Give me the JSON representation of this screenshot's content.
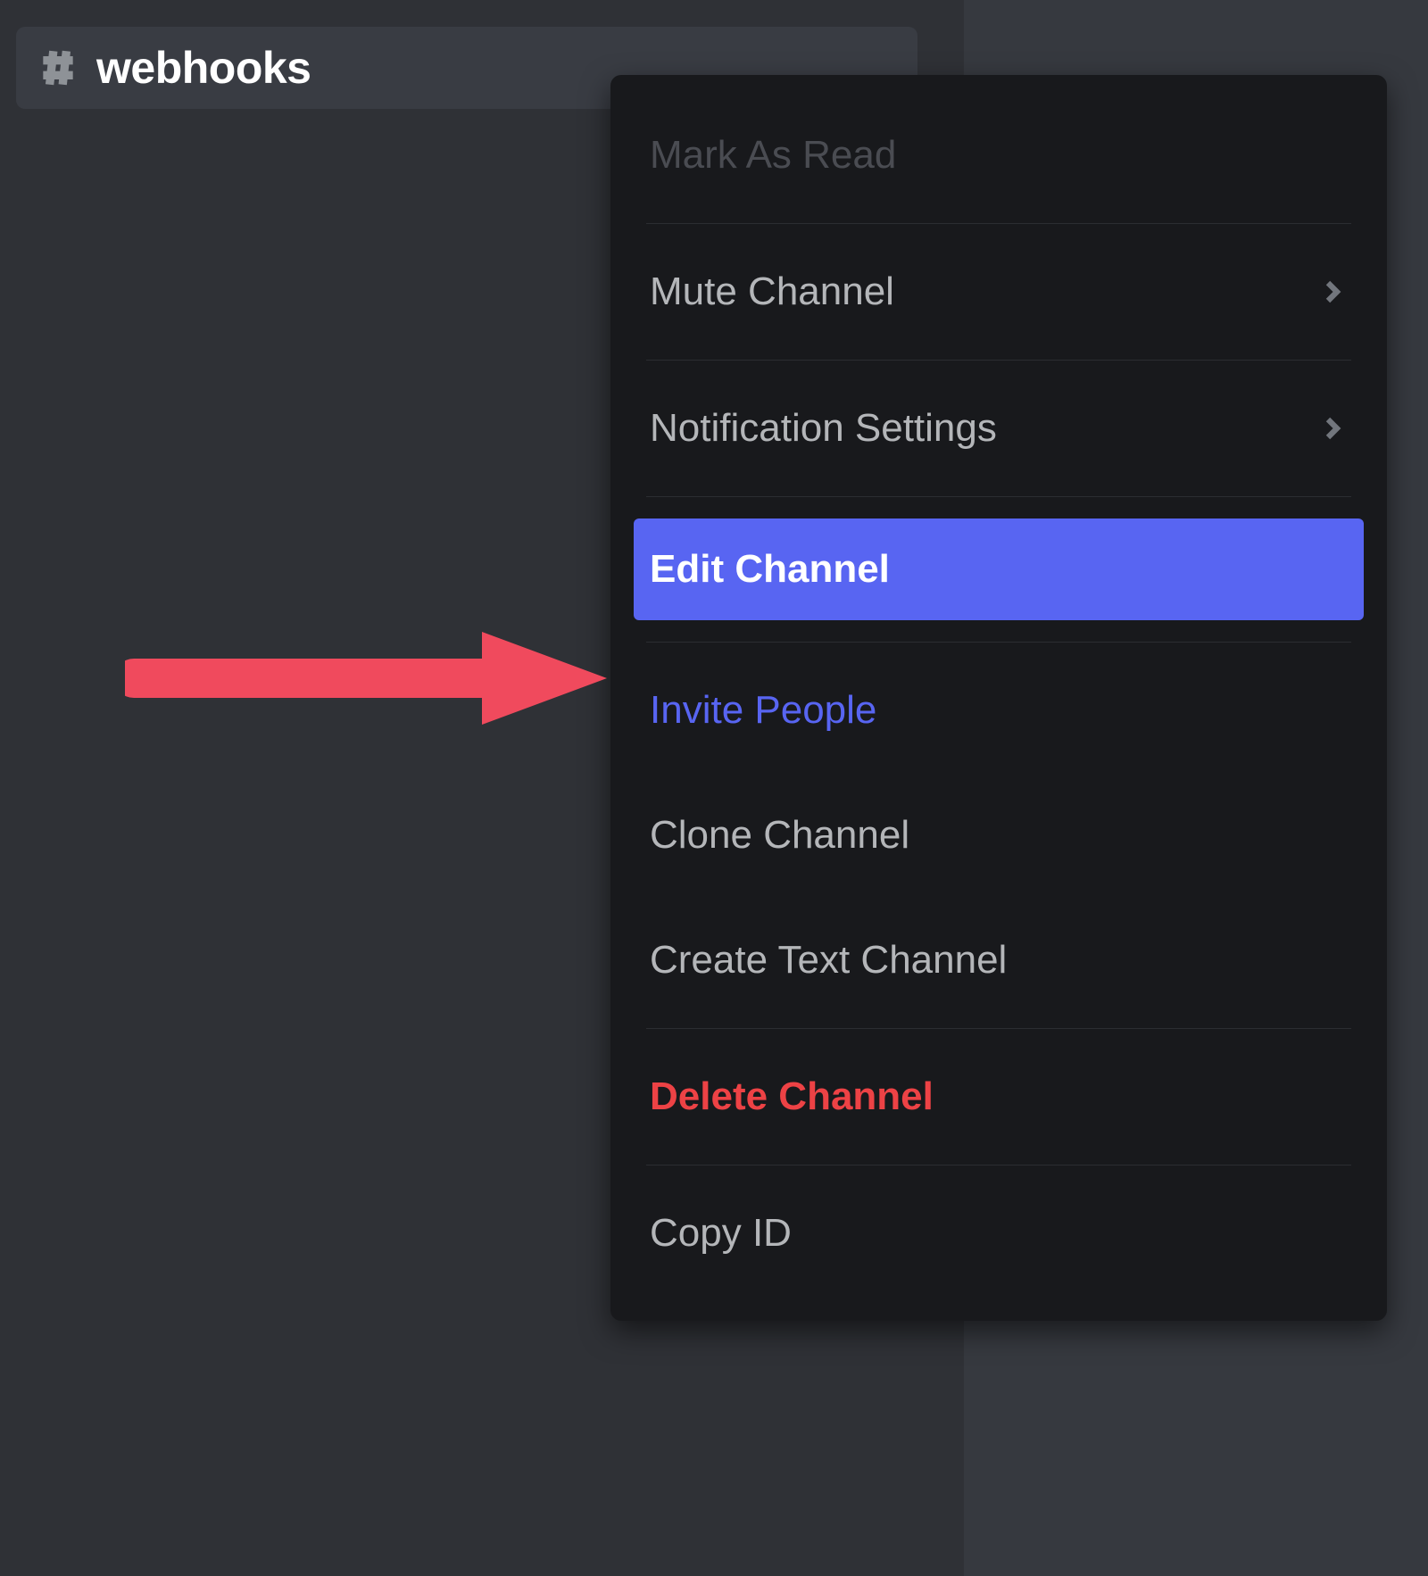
{
  "channel": {
    "name": "webhooks"
  },
  "context_menu": {
    "mark_as_read": "Mark As Read",
    "mute_channel": "Mute Channel",
    "notification_settings": "Notification Settings",
    "edit_channel": "Edit Channel",
    "invite_people": "Invite People",
    "clone_channel": "Clone Channel",
    "create_text_channel": "Create Text Channel",
    "delete_channel": "Delete Channel",
    "copy_id": "Copy ID"
  },
  "annotation": {
    "arrow_color": "#f04a5d"
  },
  "peek": {
    "big": "",
    "sub": ""
  }
}
